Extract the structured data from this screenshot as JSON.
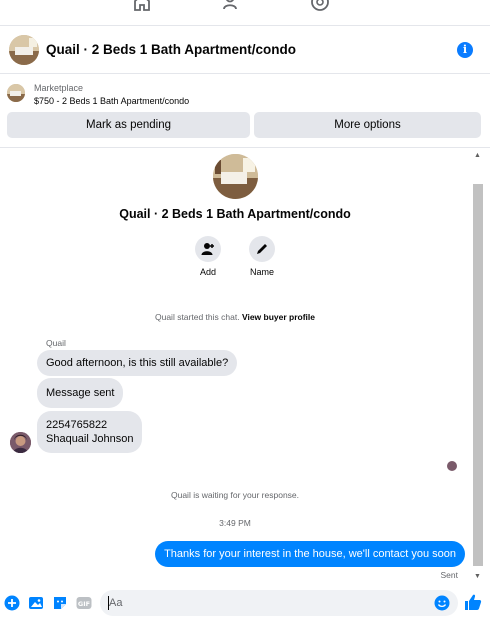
{
  "header": {
    "title": "Quail · 2 Beds 1 Bath Apartment/condo"
  },
  "marketplace": {
    "label": "Marketplace",
    "price_line": "$750 - 2 Beds 1 Bath Apartment/condo",
    "mark_pending": "Mark as pending",
    "more_options": "More options"
  },
  "chat": {
    "title": "Quail · 2 Beds 1 Bath Apartment/condo",
    "add_label": "Add",
    "name_label": "Name",
    "started_text": "Quail started this chat.",
    "view_profile": "View buyer profile",
    "sender_name": "Quail",
    "messages_in": [
      "Good afternoon, is this still available?",
      "Message sent",
      "2254765822",
      "Shaquail Johnson"
    ],
    "waiting_text": "Quail is waiting for your response.",
    "time": "3:49 PM",
    "message_out": "Thanks for your interest in the house, we'll contact you soon",
    "sent_status": "Sent"
  },
  "composer": {
    "placeholder": "Aa"
  },
  "colors": {
    "accent": "#0084ff",
    "bubble_in": "#e4e6eb"
  },
  "icons": [
    "home-icon",
    "people-icon",
    "groups-icon",
    "info-icon",
    "add-person-icon",
    "pencil-icon",
    "plus-icon",
    "image-icon",
    "sticker-icon",
    "gif-icon",
    "emoji-icon",
    "thumbs-up-icon"
  ]
}
